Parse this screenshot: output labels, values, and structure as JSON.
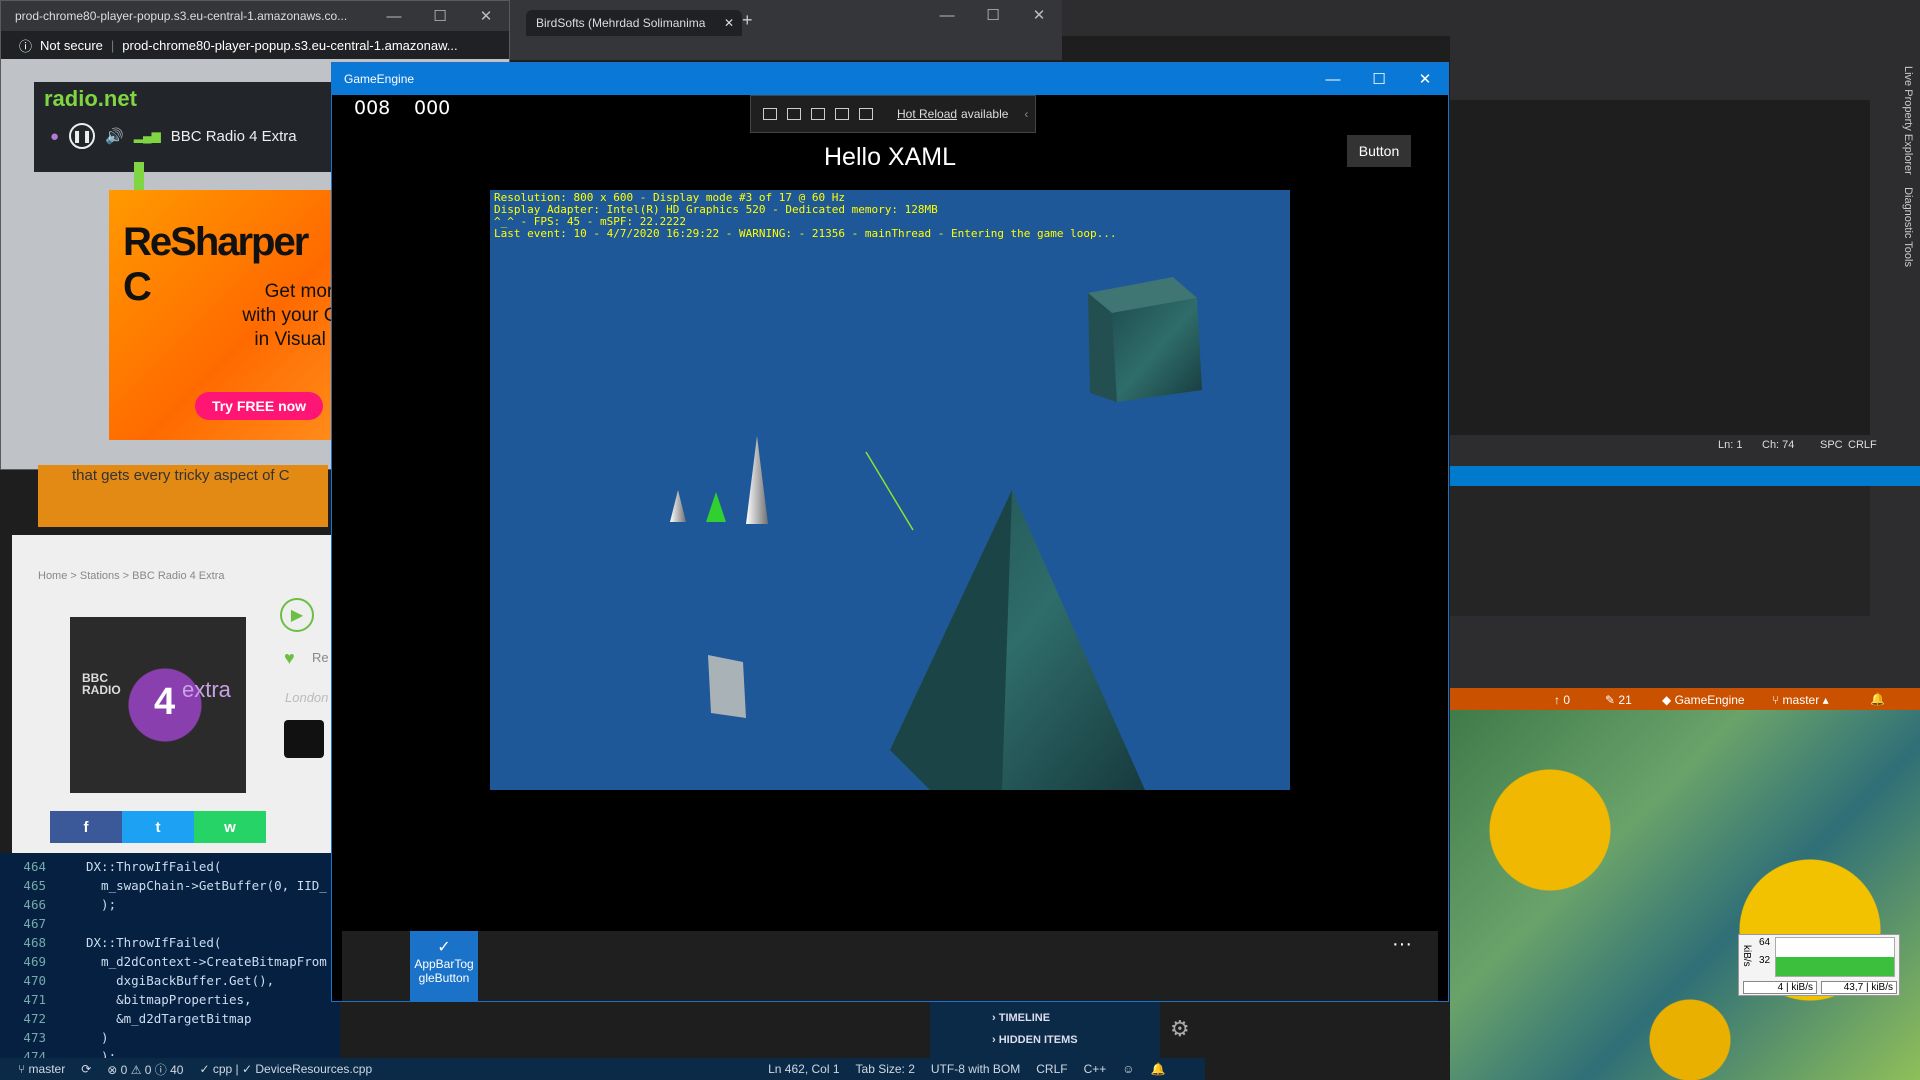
{
  "chrome_popup": {
    "tab_title": "prod-chrome80-player-popup.s3.eu-central-1.amazonaws.co...",
    "security": "Not secure",
    "url": "prod-chrome80-player-popup.s3.eu-central-1.amazonaw..."
  },
  "chrome_main": {
    "tab_title": "BirdSofts (Mehrdad Solimanima"
  },
  "radio": {
    "logo": "radio.net",
    "station": "BBC Radio 4 Extra"
  },
  "ad": {
    "headline": "ReSharper C",
    "line1": "Get more help",
    "line2": "with your C++ co",
    "line3": "in Visual Studio",
    "cta": "Try FREE now"
  },
  "banner2": {
    "text": "that gets every tricky aspect of C"
  },
  "station_page": {
    "breadcrumbs": "Home  >  Stations  >  BBC Radio 4 Extra",
    "cover_text": "BBC\nRADIO",
    "cover_extra": "extra",
    "cover_number": "4",
    "side_text1": "Re",
    "side_text2": "London",
    "social": [
      "f",
      "t",
      "w"
    ]
  },
  "code": {
    "lines": [
      {
        "n": "464",
        "t": "DX::ThrowIfFailed("
      },
      {
        "n": "465",
        "t": "  m_swapChain->GetBuffer(0, IID_"
      },
      {
        "n": "466",
        "t": "  );"
      },
      {
        "n": "467",
        "t": ""
      },
      {
        "n": "468",
        "t": "DX::ThrowIfFailed("
      },
      {
        "n": "469",
        "t": "  m_d2dContext->CreateBitmapFrom"
      },
      {
        "n": "470",
        "t": "    dxgiBackBuffer.Get(),"
      },
      {
        "n": "471",
        "t": "    &bitmapProperties,"
      },
      {
        "n": "472",
        "t": "    &m_d2dTargetBitmap"
      },
      {
        "n": "473",
        "t": "  )"
      },
      {
        "n": "474",
        "t": "  );"
      }
    ]
  },
  "status_bar": {
    "branch": "master",
    "problems": "⊗ 0 ⚠ 0 ⓘ 40",
    "lang": "✓ cpp | ✓ DeviceResources.cpp",
    "pos": "Ln 462, Col 1",
    "tab": "Tab Size: 2",
    "enc": "UTF-8 with BOM",
    "eol": "CRLF",
    "mode": "C++"
  },
  "outline": {
    "item1": "TIMELINE",
    "item2": "HIDDEN ITEMS"
  },
  "vs": {
    "ln": "Ln: 1",
    "ch": "Ch: 74",
    "spc": "SPC",
    "crlf": "CRLF",
    "side1": "Live Property Explorer",
    "side2": "Diagnostic Tools",
    "orange": {
      "up": "0",
      "edits": "21",
      "project": "GameEngine",
      "branch": "master"
    }
  },
  "game": {
    "title": "GameEngine",
    "counter_left": "008",
    "counter_right": "000",
    "hot_reload": "Hot Reload",
    "hot_reload_suffix": "available",
    "hello": "Hello XAML",
    "button": "Button",
    "debug": "Resolution: 800 x 600 - Display mode #3 of 17 @ 60 Hz\nDisplay Adapter: Intel(R) HD Graphics 520 - Dedicated memory: 128MB\n^_^ - FPS: 45 - mSPF: 22.2222\nLast event: 10 - 4/7/2020 16:29:22 - WARNING: - 21356 - mainThread - Entering the game loop...",
    "appbar_toggle": "AppBarTog\ngleButton",
    "more": "···"
  },
  "net": {
    "unit": "kiB/s",
    "v64": "64",
    "v32": "32",
    "axis": "kiB/s",
    "down": "4",
    "up": "43,7"
  },
  "colors": {
    "accent": "#0a78d7",
    "scene_bg": "#1f5898",
    "debug_text": "#ffff00",
    "vs_orange": "#ca5100"
  }
}
